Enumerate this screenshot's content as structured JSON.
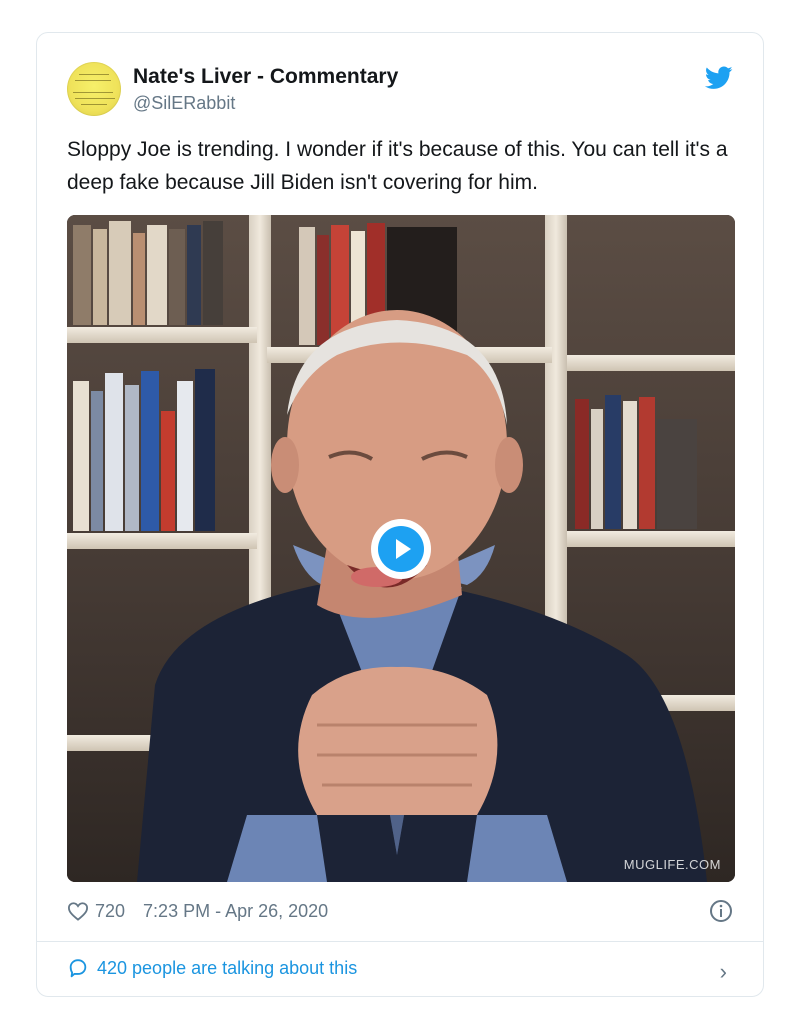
{
  "tweet": {
    "author": {
      "display_name": "Nate's Liver - Commentary",
      "handle": "@SilERabbit"
    },
    "text": "Sloppy Joe is trending. I wonder if it's because of this. You can tell it's a deep fake because Jill Biden isn't covering for him.",
    "media": {
      "watermark": "MUGLIFE.COM",
      "play_icon": "play-icon"
    },
    "likes": "720",
    "timestamp": "7:23 PM - Apr 26, 2020",
    "conversation_label": "420 people are talking about this"
  },
  "colors": {
    "accent": "#1da1f2",
    "link": "#1b95e0",
    "secondary_text": "#657786",
    "border": "#e1e8ed"
  }
}
